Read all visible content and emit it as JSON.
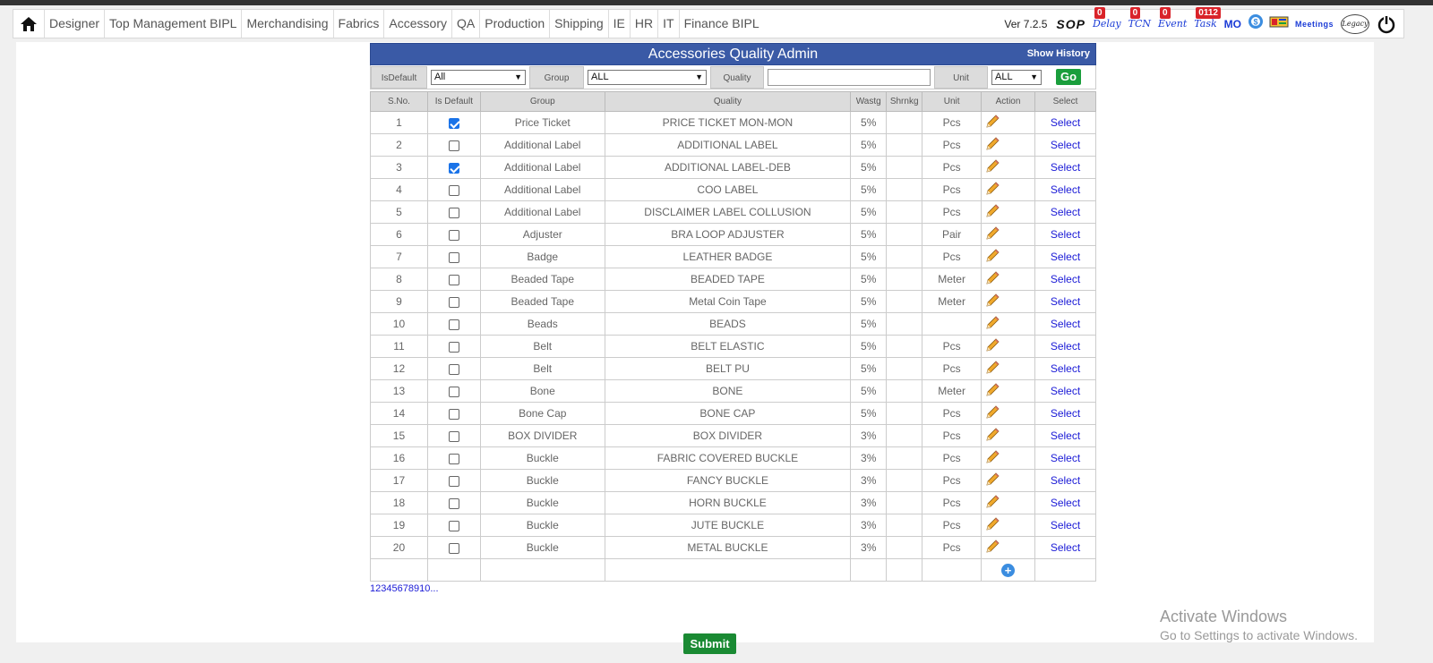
{
  "nav": {
    "items": [
      "Designer",
      "Top Management BIPL",
      "Merchandising",
      "Fabrics",
      "Accessory",
      "QA",
      "Production",
      "Shipping",
      "IE",
      "HR",
      "IT",
      "Finance BIPL"
    ],
    "version": "Ver 7.2.5",
    "sop": "SOP",
    "delay_label": "Delay",
    "delay_count": "0",
    "tcn_label": "TCN",
    "tcn_count": "0",
    "event_label": "Event",
    "event_count": "0",
    "task_label": "Task",
    "task_count": "0112",
    "mo_label": "MO",
    "meetings": "Meetings",
    "legacy": "Legacy"
  },
  "panel": {
    "title": "Accessories Quality Admin",
    "show_history": "Show History"
  },
  "filters": {
    "isdefault_label": "IsDefault",
    "isdefault_value": "All",
    "group_label": "Group",
    "group_value": "ALL",
    "quality_label": "Quality",
    "quality_value": "",
    "unit_label": "Unit",
    "unit_value": "ALL",
    "go": "Go"
  },
  "table": {
    "headers": [
      "S.No.",
      "Is Default",
      "Group",
      "Quality",
      "Wastg",
      "Shrnkg",
      "Unit",
      "Action",
      "Select"
    ],
    "select_label": "Select",
    "rows": [
      {
        "sno": "1",
        "def": true,
        "group": "Price Ticket",
        "quality": "PRICE TICKET MON-MON",
        "wastg": "5%",
        "shrnkg": "",
        "unit": "Pcs"
      },
      {
        "sno": "2",
        "def": false,
        "group": "Additional Label",
        "quality": "ADDITIONAL LABEL",
        "wastg": "5%",
        "shrnkg": "",
        "unit": "Pcs"
      },
      {
        "sno": "3",
        "def": true,
        "group": "Additional Label",
        "quality": "ADDITIONAL LABEL-DEB",
        "wastg": "5%",
        "shrnkg": "",
        "unit": "Pcs"
      },
      {
        "sno": "4",
        "def": false,
        "group": "Additional Label",
        "quality": "COO LABEL",
        "wastg": "5%",
        "shrnkg": "",
        "unit": "Pcs"
      },
      {
        "sno": "5",
        "def": false,
        "group": "Additional Label",
        "quality": "DISCLAIMER LABEL COLLUSION",
        "wastg": "5%",
        "shrnkg": "",
        "unit": "Pcs"
      },
      {
        "sno": "6",
        "def": false,
        "group": "Adjuster",
        "quality": "BRA LOOP ADJUSTER",
        "wastg": "5%",
        "shrnkg": "",
        "unit": "Pair"
      },
      {
        "sno": "7",
        "def": false,
        "group": "Badge",
        "quality": "LEATHER BADGE",
        "wastg": "5%",
        "shrnkg": "",
        "unit": "Pcs"
      },
      {
        "sno": "8",
        "def": false,
        "group": "Beaded Tape",
        "quality": "BEADED TAPE",
        "wastg": "5%",
        "shrnkg": "",
        "unit": "Meter"
      },
      {
        "sno": "9",
        "def": false,
        "group": "Beaded Tape",
        "quality": "Metal Coin Tape",
        "wastg": "5%",
        "shrnkg": "",
        "unit": "Meter"
      },
      {
        "sno": "10",
        "def": false,
        "group": "Beads",
        "quality": "BEADS",
        "wastg": "5%",
        "shrnkg": "",
        "unit": ""
      },
      {
        "sno": "11",
        "def": false,
        "group": "Belt",
        "quality": "BELT ELASTIC",
        "wastg": "5%",
        "shrnkg": "",
        "unit": "Pcs"
      },
      {
        "sno": "12",
        "def": false,
        "group": "Belt",
        "quality": "BELT PU",
        "wastg": "5%",
        "shrnkg": "",
        "unit": "Pcs"
      },
      {
        "sno": "13",
        "def": false,
        "group": "Bone",
        "quality": "BONE",
        "wastg": "5%",
        "shrnkg": "",
        "unit": "Meter"
      },
      {
        "sno": "14",
        "def": false,
        "group": "Bone Cap",
        "quality": "BONE CAP",
        "wastg": "5%",
        "shrnkg": "",
        "unit": "Pcs"
      },
      {
        "sno": "15",
        "def": false,
        "group": "BOX DIVIDER",
        "quality": "BOX DIVIDER",
        "wastg": "3%",
        "shrnkg": "",
        "unit": "Pcs"
      },
      {
        "sno": "16",
        "def": false,
        "group": "Buckle",
        "quality": "FABRIC COVERED BUCKLE",
        "wastg": "3%",
        "shrnkg": "",
        "unit": "Pcs"
      },
      {
        "sno": "17",
        "def": false,
        "group": "Buckle",
        "quality": "FANCY BUCKLE",
        "wastg": "3%",
        "shrnkg": "",
        "unit": "Pcs"
      },
      {
        "sno": "18",
        "def": false,
        "group": "Buckle",
        "quality": "HORN BUCKLE",
        "wastg": "3%",
        "shrnkg": "",
        "unit": "Pcs"
      },
      {
        "sno": "19",
        "def": false,
        "group": "Buckle",
        "quality": "JUTE BUCKLE",
        "wastg": "3%",
        "shrnkg": "",
        "unit": "Pcs"
      },
      {
        "sno": "20",
        "def": false,
        "group": "Buckle",
        "quality": "METAL BUCKLE",
        "wastg": "3%",
        "shrnkg": "",
        "unit": "Pcs"
      }
    ]
  },
  "pager": {
    "pages": [
      "1",
      "2",
      "3",
      "4",
      "5",
      "6",
      "7",
      "8",
      "9",
      "10",
      "..."
    ],
    "current": "1"
  },
  "watermark": {
    "line1": "Activate Windows",
    "line2": "Go to Settings to activate Windows."
  },
  "submit": "Submit"
}
